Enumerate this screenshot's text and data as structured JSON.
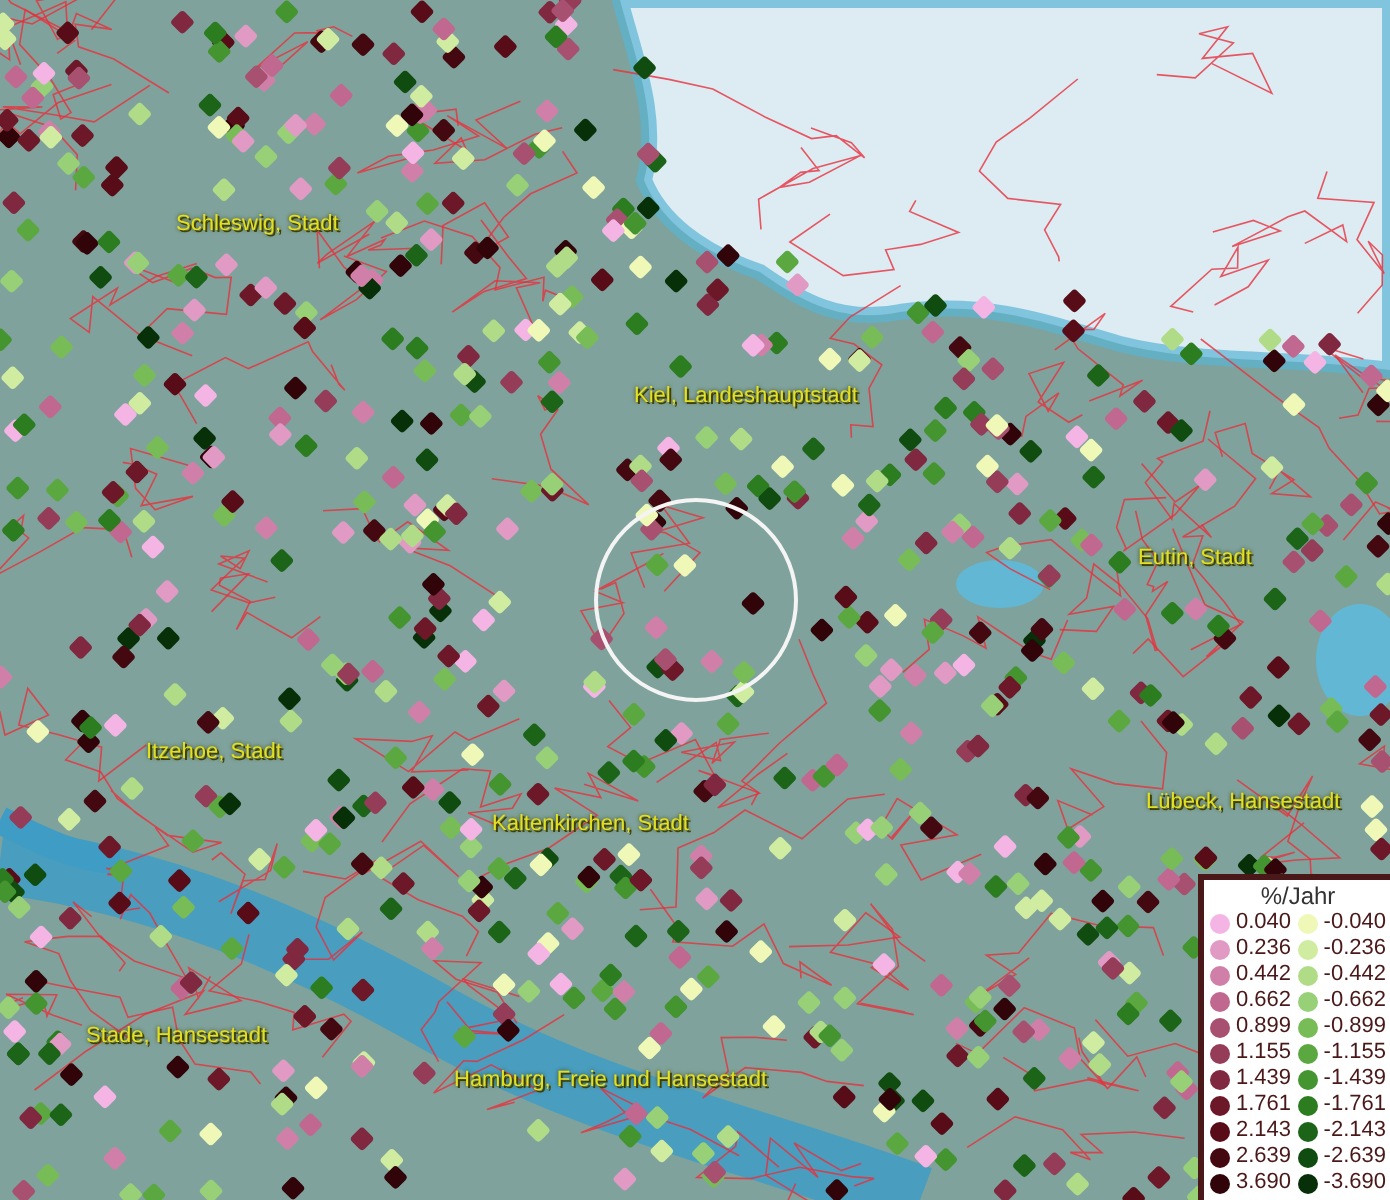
{
  "places": [
    {
      "name": "Schleswig, Stadt"
    },
    {
      "name": "Kiel, Landeshauptstadt"
    },
    {
      "name": "Eutin, Stadt"
    },
    {
      "name": "Itzehoe, Stadt"
    },
    {
      "name": "Kaltenkirchen, Stadt"
    },
    {
      "name": "Lübeck, Hansestadt"
    },
    {
      "name": "Stade, Hansestadt"
    },
    {
      "name": "Hamburg, Freie und Hansestadt"
    }
  ],
  "legend": {
    "title": "%/Jahr",
    "positive": [
      {
        "value": "0.040",
        "color": "#f4b4e4"
      },
      {
        "value": "0.236",
        "color": "#e09ac4"
      },
      {
        "value": "0.442",
        "color": "#d080a8"
      },
      {
        "value": "0.662",
        "color": "#c06890"
      },
      {
        "value": "0.899",
        "color": "#a85070"
      },
      {
        "value": "1.155",
        "color": "#943c58"
      },
      {
        "value": "1.439",
        "color": "#802840"
      },
      {
        "value": "1.761",
        "color": "#6c1828"
      },
      {
        "value": "2.143",
        "color": "#580c18"
      },
      {
        "value": "2.639",
        "color": "#440810"
      },
      {
        "value": "3.690",
        "color": "#300408"
      }
    ],
    "negative": [
      {
        "value": "-0.040",
        "color": "#f0f8b8"
      },
      {
        "value": "-0.236",
        "color": "#d0eca0"
      },
      {
        "value": "-0.442",
        "color": "#b0dc88"
      },
      {
        "value": "-0.662",
        "color": "#98d078"
      },
      {
        "value": "-0.899",
        "color": "#78bc58"
      },
      {
        "value": "-1.155",
        "color": "#5ca840"
      },
      {
        "value": "-1.439",
        "color": "#449430"
      },
      {
        "value": "-1.761",
        "color": "#2c7c20"
      },
      {
        "value": "-2.143",
        "color": "#1c6418"
      },
      {
        "value": "-2.639",
        "color": "#104c10"
      },
      {
        "value": "-3.690",
        "color": "#083008"
      }
    ]
  }
}
